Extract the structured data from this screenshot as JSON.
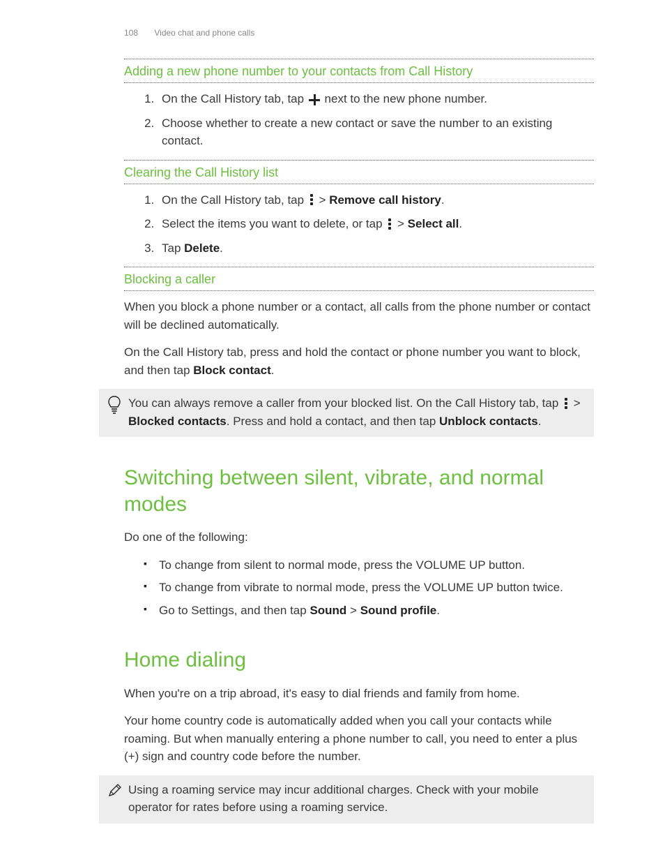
{
  "header": {
    "page_number": "108",
    "breadcrumb": "Video chat and phone calls"
  },
  "section1": {
    "title": "Adding a new phone number to your contacts from Call History",
    "step1_pre": "On the Call History tab, tap ",
    "step1_post": " next to the new phone number.",
    "step2": "Choose whether to create a new contact or save the number to an existing contact."
  },
  "section2": {
    "title": "Clearing the Call History list",
    "step1_pre": "On the Call History tab, tap ",
    "step1_mid": " > ",
    "step1_bold": "Remove call history",
    "step1_end": ".",
    "step2_pre": "Select the items you want to delete, or tap ",
    "step2_mid": " > ",
    "step2_bold": "Select all",
    "step2_end": ".",
    "step3_pre": "Tap ",
    "step3_bold": "Delete",
    "step3_end": "."
  },
  "section3": {
    "title": "Blocking a caller",
    "para1": "When you block a phone number or a contact, all calls from the phone number or contact will be declined automatically.",
    "para2_pre": "On the Call History tab, press and hold the contact or phone number you want to block, and then tap ",
    "para2_bold": "Block contact",
    "para2_end": ".",
    "tip_pre": "You can always remove a caller from your blocked list. On the Call History tab, tap ",
    "tip_mid1": " > ",
    "tip_bold1": "Blocked contacts",
    "tip_mid2": ". Press and hold a contact, and then tap ",
    "tip_bold2": "Unblock contacts",
    "tip_end": "."
  },
  "section4": {
    "title": "Switching between silent, vibrate, and normal modes",
    "intro": "Do one of the following:",
    "bullet1": "To change from silent to normal mode, press the VOLUME UP button.",
    "bullet2": "To change from vibrate to normal mode, press the VOLUME UP button twice.",
    "bullet3_pre": "Go to Settings, and then tap ",
    "bullet3_b1": "Sound",
    "bullet3_mid": " > ",
    "bullet3_b2": "Sound profile",
    "bullet3_end": "."
  },
  "section5": {
    "title": "Home dialing",
    "para1": "When you're on a trip abroad, it's easy to dial friends and family from home.",
    "para2": "Your home country code is automatically added when you call your contacts while roaming. But when manually entering a phone number to call, you need to enter a plus (+) sign and country code before the number.",
    "note": "Using a roaming service may incur additional charges. Check with your mobile operator for rates before using a roaming service."
  }
}
